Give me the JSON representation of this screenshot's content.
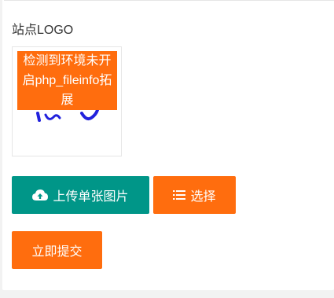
{
  "form": {
    "logo_label": "站点LOGO",
    "logo_preview": {
      "warning_text": "检测到环境未开启php_fileinfo拓展"
    },
    "upload_button_label": "上传单张图片",
    "select_button_label": "选择",
    "submit_button_label": "立即提交"
  },
  "icons": {
    "upload": "cloud-upload-icon",
    "select": "list-icon"
  },
  "colors": {
    "primary_teal": "#009688",
    "accent_orange": "#ff6d0e",
    "logo_stroke_blue": "#2222dd"
  }
}
